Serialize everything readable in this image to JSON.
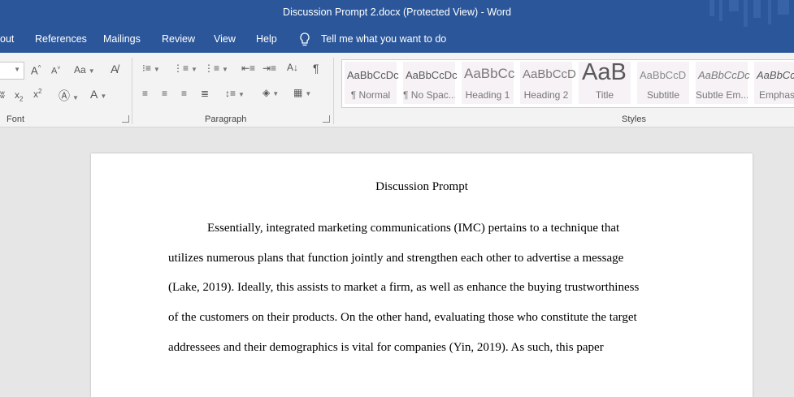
{
  "window": {
    "title": "Discussion Prompt 2.docx (Protected View)  -  Word"
  },
  "menu": [
    "out",
    "References",
    "Mailings",
    "Review",
    "View",
    "Help"
  ],
  "tell_me": "Tell me what you want to do",
  "ribbon": {
    "groups": {
      "font": "Font",
      "paragraph": "Paragraph",
      "styles": "Styles"
    },
    "styles": [
      {
        "sample": "AaBbCcDc",
        "name": "¶ Normal"
      },
      {
        "sample": "AaBbCcDc",
        "name": "¶ No Spac..."
      },
      {
        "sample": "AaBbCc",
        "name": "Heading 1"
      },
      {
        "sample": "AaBbCcD",
        "name": "Heading 2"
      },
      {
        "sample": "AaB",
        "name": "Title"
      },
      {
        "sample": "AaBbCcD",
        "name": "Subtitle"
      },
      {
        "sample": "AaBbCcDc",
        "name": "Subtle Em..."
      },
      {
        "sample": "AaBbCc",
        "name": "Emphas"
      }
    ]
  },
  "document": {
    "title": "Discussion Prompt",
    "lines": [
      "Essentially, integrated marketing communications (IMC) pertains to a technique that",
      "utilizes numerous plans that function jointly and strengthen each other to advertise a message",
      "(Lake, 2019). Ideally, this assists to market a firm, as well as enhance the buying trustworthiness",
      "of the customers on their products. On the other hand, evaluating those who constitute the target",
      "addressees and their demographics is vital for companies (Yin, 2019). As such, this paper"
    ]
  }
}
